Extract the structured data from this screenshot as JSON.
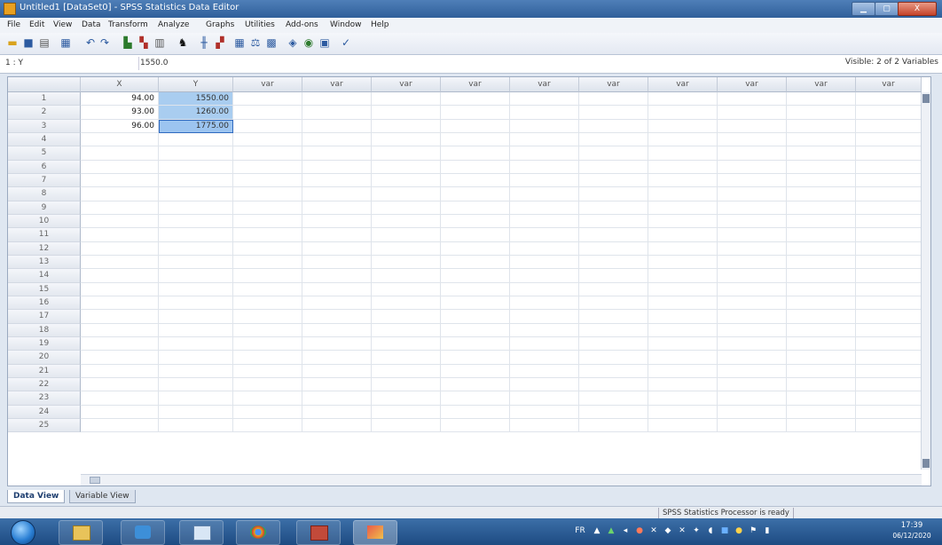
{
  "window": {
    "title": "Untitled1 [DataSet0] - SPSS Statistics Data Editor",
    "minimize_icon": "minimize-icon",
    "maximize_icon": "maximize-icon",
    "close_label": "X"
  },
  "menu": [
    "File",
    "Edit",
    "View",
    "Data",
    "Transform",
    "Analyze",
    "Graphs",
    "Utilities",
    "Add-ons",
    "Window",
    "Help"
  ],
  "toolbar_icons": [
    "open-icon",
    "save-icon",
    "print-icon",
    "dialog-recall-icon",
    "undo-icon",
    "redo-icon",
    "goto-case-icon",
    "goto-variable-icon",
    "variables-icon",
    "find-icon",
    "insert-cases-icon",
    "insert-variable-icon",
    "split-file-icon",
    "weight-cases-icon",
    "select-cases-icon",
    "value-labels-icon",
    "use-sets-icon",
    "show-all-icon",
    "spelling-icon"
  ],
  "ref_bar": {
    "cell_ref": "1 : Y",
    "cell_value": "1550.0",
    "visible_text": "Visible: 2 of 2 Variables"
  },
  "grid": {
    "columns": [
      "X",
      "Y",
      "var",
      "var",
      "var",
      "var",
      "var",
      "var",
      "var",
      "var",
      "var",
      "var"
    ],
    "row_numbers": [
      "1",
      "2",
      "3",
      "4",
      "5",
      "6",
      "7",
      "8",
      "9",
      "10",
      "11",
      "12",
      "13",
      "14",
      "15",
      "16",
      "17",
      "18",
      "19",
      "20",
      "21",
      "22",
      "23",
      "24",
      "25"
    ],
    "rows": [
      {
        "x": "94.00",
        "y": "1550.00"
      },
      {
        "x": "93.00",
        "y": "1260.00"
      },
      {
        "x": "96.00",
        "y": "1775.00"
      }
    ],
    "selection_color": "#a9cdf0"
  },
  "tabs": {
    "data_view": "Data View",
    "variable_view": "Variable View"
  },
  "status": {
    "processor": "SPSS Statistics  Processor is ready"
  },
  "taskbar": {
    "apps": [
      "explorer-icon",
      "media-player-icon",
      "picture-viewer-icon",
      "chrome-icon",
      "spss-icon",
      "paint-icon"
    ],
    "tray_label": "FR",
    "time": "17:39",
    "date": "06/12/2020"
  }
}
